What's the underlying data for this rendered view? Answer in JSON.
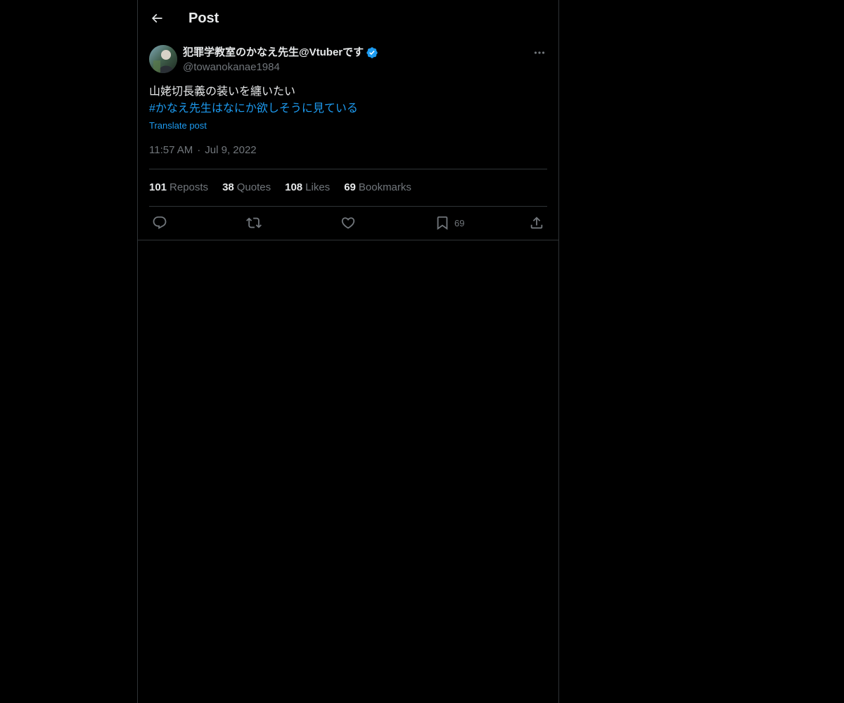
{
  "header": {
    "title": "Post",
    "back_icon": "arrow-left-icon"
  },
  "post": {
    "author": {
      "name": "犯罪学教室のかなえ先生@Vtuberです",
      "handle": "@towanokanae1984",
      "verified": true,
      "verified_color": "#1d9bf0"
    },
    "text": "山姥切長義の装いを纏いたい",
    "hashtag": "#かなえ先生はなにか欲しそうに見ている",
    "translate_label": "Translate post",
    "time": "11:57 AM",
    "date": "Jul 9, 2022",
    "stats": {
      "reposts": {
        "value": "101",
        "label": "Reposts"
      },
      "quotes": {
        "value": "38",
        "label": "Quotes"
      },
      "likes": {
        "value": "108",
        "label": "Likes"
      },
      "bookmarks": {
        "value": "69",
        "label": "Bookmarks"
      }
    },
    "actions": {
      "reply": {
        "icon": "reply-icon"
      },
      "repost": {
        "icon": "repost-icon"
      },
      "like": {
        "icon": "heart-icon"
      },
      "bookmark": {
        "icon": "bookmark-icon",
        "count": "69"
      },
      "share": {
        "icon": "share-icon"
      }
    }
  },
  "colors": {
    "background": "#000000",
    "text_primary": "#e7e9ea",
    "text_secondary": "#71767b",
    "accent": "#1d9bf0",
    "border": "#2f3336"
  }
}
